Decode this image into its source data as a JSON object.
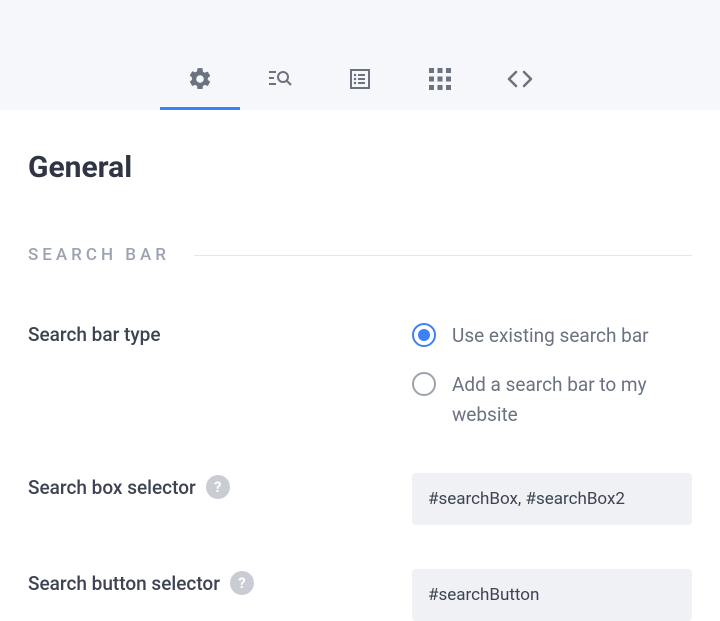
{
  "tabs": [
    {
      "id": "general",
      "icon": "gear-icon",
      "active": true
    },
    {
      "id": "search",
      "icon": "search-list-icon",
      "active": false
    },
    {
      "id": "form",
      "icon": "form-icon",
      "active": false
    },
    {
      "id": "grid",
      "icon": "grid-icon",
      "active": false
    },
    {
      "id": "code",
      "icon": "code-icon",
      "active": false
    }
  ],
  "page": {
    "title": "General"
  },
  "section": {
    "search_bar": {
      "heading": "SEARCH BAR",
      "type_label": "Search bar type",
      "options": {
        "existing": "Use existing search bar",
        "add": "Add a search bar to my website"
      },
      "selected": "existing",
      "box_selector": {
        "label": "Search box selector",
        "value": "#searchBox, #searchBox2"
      },
      "button_selector": {
        "label": "Search button selector",
        "value": "#searchButton"
      }
    }
  }
}
